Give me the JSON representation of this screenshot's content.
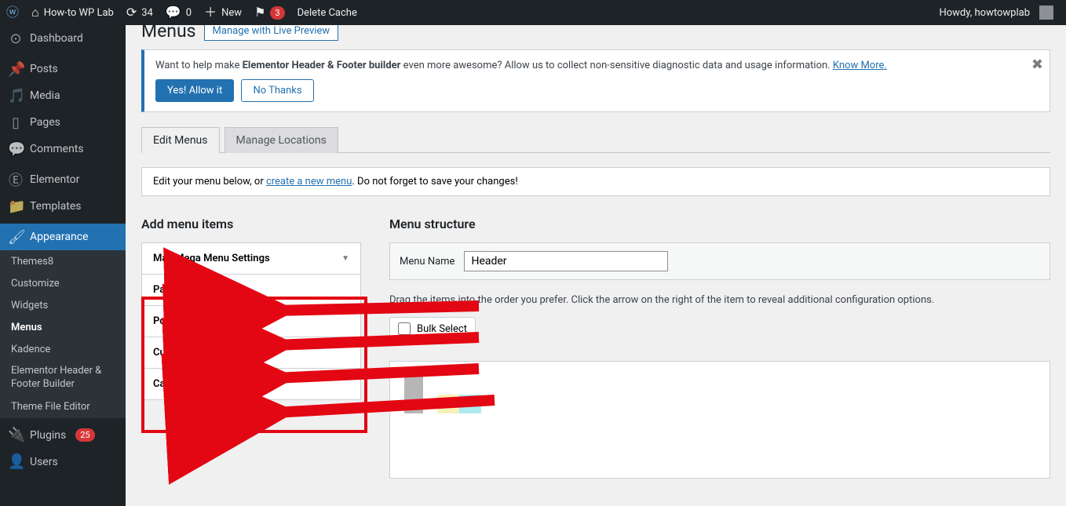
{
  "adminbar": {
    "site_name": "How-to WP Lab",
    "updates": "34",
    "comments": "0",
    "new": "New",
    "notif": "3",
    "delete_cache": "Delete Cache",
    "howdy": "Howdy, howtowplab"
  },
  "menu": {
    "dashboard": "Dashboard",
    "posts": "Posts",
    "media": "Media",
    "pages": "Pages",
    "comments": "Comments",
    "elementor": "Elementor",
    "templates": "Templates",
    "appearance": "Appearance",
    "plugins": "Plugins",
    "plugins_count": "25",
    "users": "Users"
  },
  "submenu": {
    "themes": "Themes",
    "themes_count": "8",
    "customize": "Customize",
    "widgets": "Widgets",
    "menus": "Menus",
    "kadence": "Kadence",
    "ehfb": "Elementor Header & Footer Builder",
    "tfe": "Theme File Editor"
  },
  "page": {
    "title": "Menus",
    "live_preview": "Manage with Live Preview",
    "notice_pre": "Want to help make ",
    "notice_bold": "Elementor Header & Footer builder",
    "notice_post": " even more awesome? Allow us to collect non-sensitive diagnostic data and usage information. ",
    "notice_link": "Know More.",
    "allow": "Yes! Allow it",
    "nothanks": "No Thanks",
    "tab_edit": "Edit Menus",
    "tab_locations": "Manage Locations",
    "info_pre": "Edit your menu below, or ",
    "info_link": "create a new menu",
    "info_post": ". Do not forget to save your changes!",
    "add_title": "Add menu items",
    "struct_title": "Menu structure",
    "menu_name_label": "Menu Name",
    "menu_name_value": "Header",
    "drag_help": "Drag the items into the order you prefer. Click the arrow on the right of the item to reveal additional configuration options.",
    "bulk": "Bulk Select"
  },
  "accordions": {
    "mmm": "Max Mega Menu Settings",
    "pages": "Pages",
    "posts": "Posts",
    "custom": "Custom Links",
    "cats": "Categories"
  }
}
